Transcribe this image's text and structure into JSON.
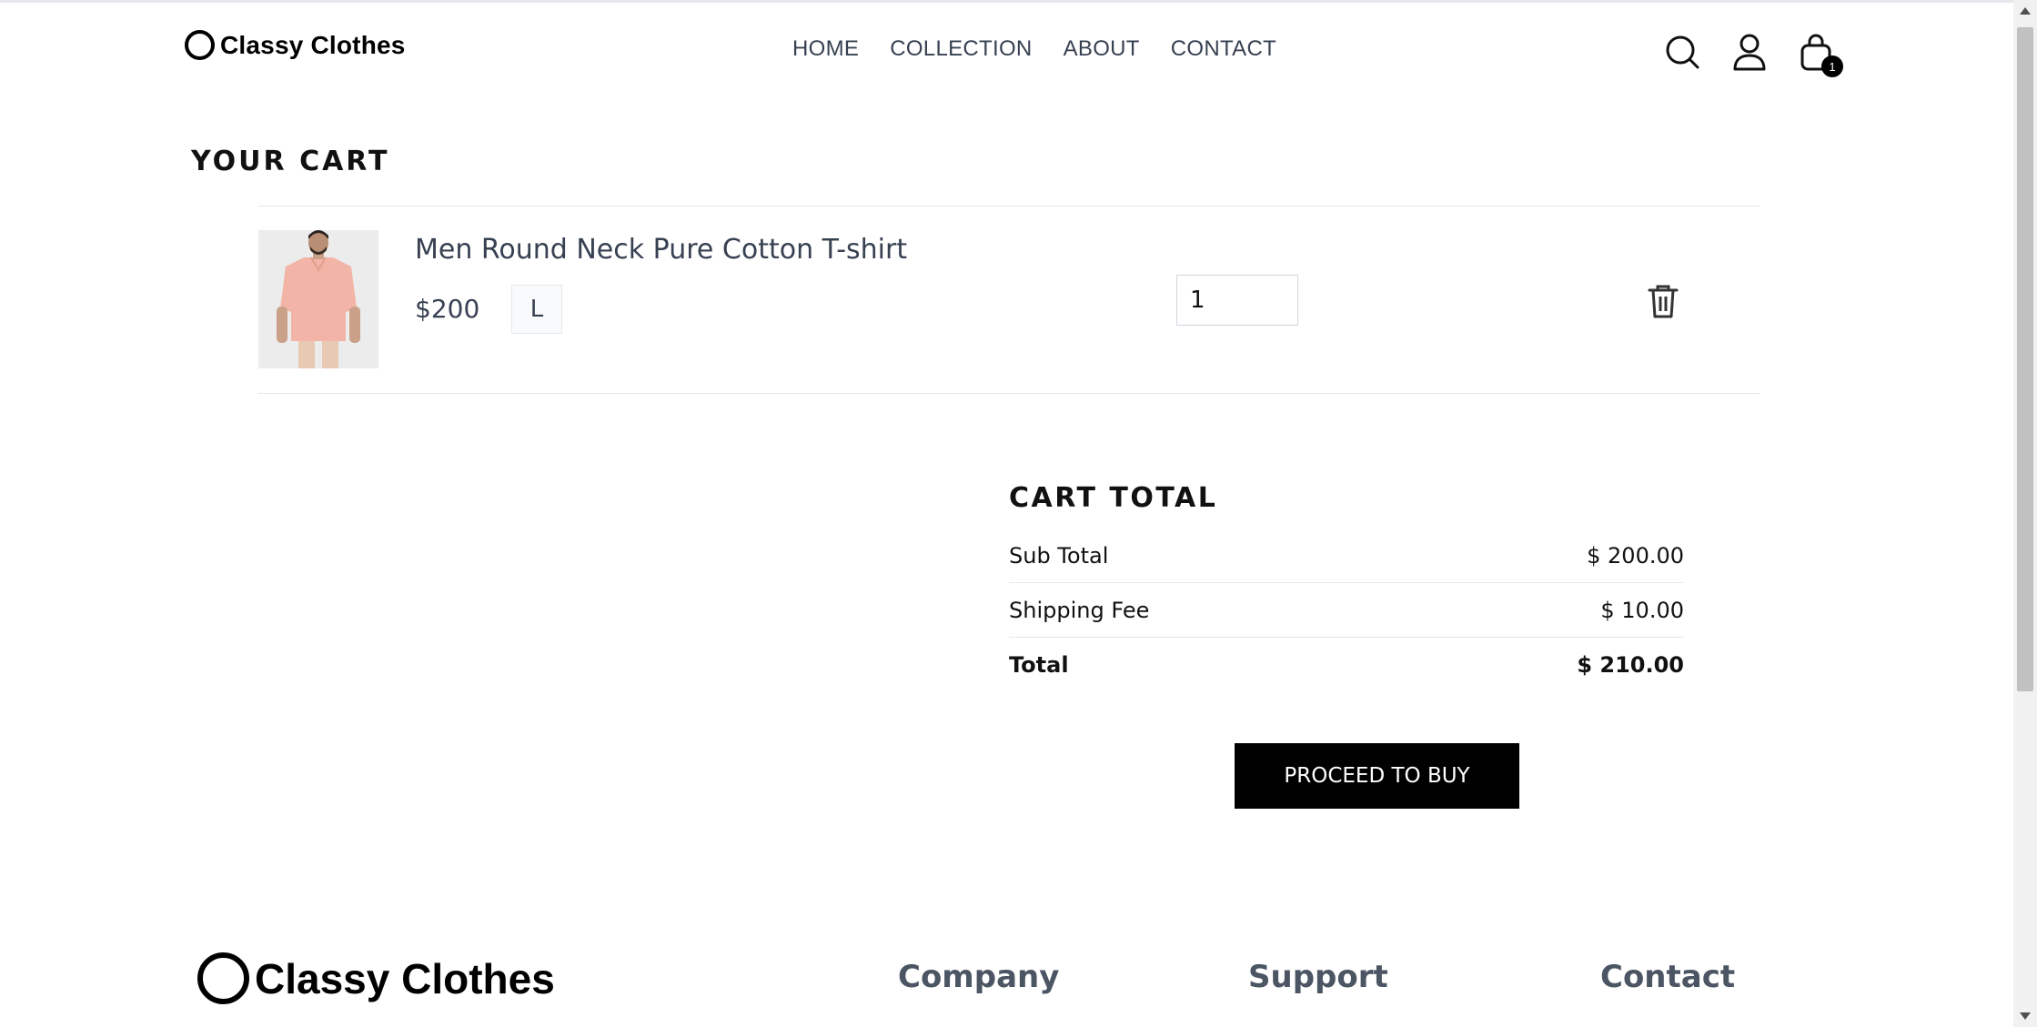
{
  "brand": {
    "name": "Classy Clothes"
  },
  "nav": {
    "items": [
      "HOME",
      "COLLECTION",
      "ABOUT",
      "CONTACT"
    ]
  },
  "header_icons": {
    "search": "search-icon",
    "profile": "user-icon",
    "cart": "shopping-bag-icon",
    "cart_count": "1"
  },
  "cart": {
    "title": "YOUR CART",
    "item": {
      "name": "Men Round Neck Pure Cotton T-shirt",
      "price": "$200",
      "size": "L",
      "quantity": "1",
      "image": "product-photo-pink-shirt",
      "delete_icon": "trash-icon"
    }
  },
  "totals": {
    "title": "CART TOTAL",
    "rows": [
      {
        "label": "Sub Total",
        "value": "$ 200.00"
      },
      {
        "label": "Shipping Fee",
        "value": "$ 10.00"
      },
      {
        "label": "Total",
        "value": "$ 210.00"
      }
    ],
    "button": "PROCEED TO BUY"
  },
  "footer": {
    "brand": "Classy Clothes",
    "headings": [
      "Company",
      "Support",
      "Contact"
    ]
  },
  "colors": {
    "accent": "#000000",
    "text": "#374151",
    "border": "#e5e7eb"
  }
}
